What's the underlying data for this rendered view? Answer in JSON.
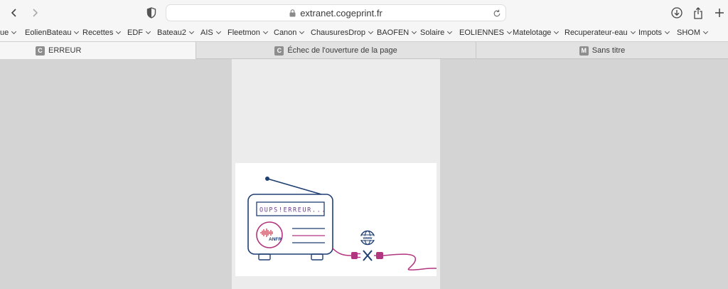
{
  "toolbar": {
    "url": "extranet.cogeprint.fr"
  },
  "bookmarks": [
    {
      "label": "ue"
    },
    {
      "label": "EolienBateau"
    },
    {
      "label": "Recettes"
    },
    {
      "label": "EDF"
    },
    {
      "label": "Bateau2"
    },
    {
      "label": "AIS"
    },
    {
      "label": "Fleetmon"
    },
    {
      "label": "Canon"
    },
    {
      "label": "ChausuresDrop"
    },
    {
      "label": "BAOFEN"
    },
    {
      "label": "Solaire"
    },
    {
      "label": "EOLIENNES"
    },
    {
      "label": "Matelotage"
    },
    {
      "label": "Recuperateur-eau"
    },
    {
      "label": "Impots"
    },
    {
      "label": "SHOM"
    }
  ],
  "tabs": [
    {
      "favicon": "C",
      "title": "ERREUR",
      "active": true
    },
    {
      "favicon": "C",
      "title": "Échec de l'ouverture de la page",
      "active": false
    },
    {
      "favicon": "M",
      "title": "Sans titre",
      "active": false
    }
  ],
  "error_card": {
    "screen_text": "OUPS!ERREUR...",
    "logo_text": "ANFR",
    "www_text": "www"
  },
  "colors": {
    "navy": "#1f3f73",
    "magenta": "#b2357f",
    "logo_red": "#c8213a"
  }
}
